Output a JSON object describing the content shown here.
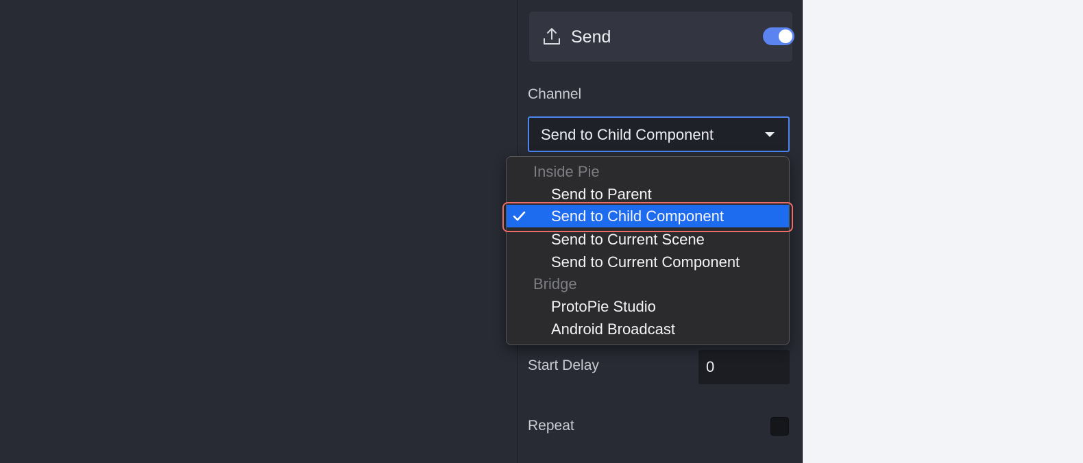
{
  "response": {
    "title": "Send",
    "icon": "upload-icon",
    "enabled": true
  },
  "channel": {
    "label": "Channel",
    "selected": "Send to Child Component"
  },
  "dropdown": {
    "groups": [
      {
        "header": "Inside Pie",
        "items": [
          "Send to Parent",
          "Send to Child Component",
          "Send to Current Scene",
          "Send to Current Component"
        ]
      },
      {
        "header": "Bridge",
        "items": [
          "ProtoPie Studio",
          "Android Broadcast"
        ]
      }
    ]
  },
  "start_delay": {
    "label": "Start Delay",
    "value": "0"
  },
  "repeat": {
    "label": "Repeat",
    "checked": false
  },
  "colors": {
    "accent": "#5b84f0",
    "selection": "#1d6cf0",
    "highlight": "#ee6c68",
    "panel_bg": "#282b34"
  }
}
